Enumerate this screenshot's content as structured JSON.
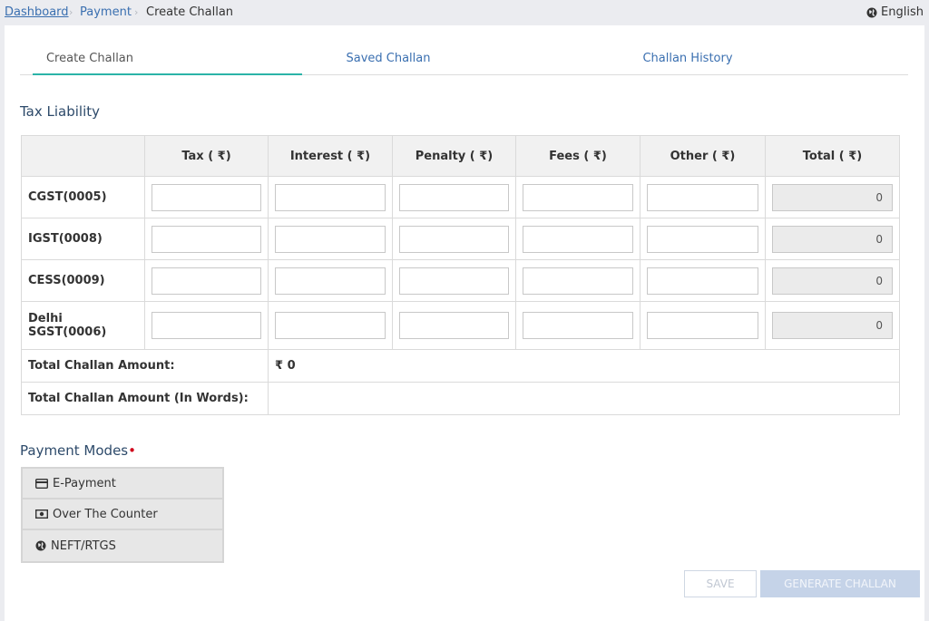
{
  "breadcrumb": {
    "items": [
      "Dashboard",
      "Payment",
      "Create Challan"
    ],
    "separator": "›"
  },
  "language": {
    "label": "English",
    "icon": "globe-icon"
  },
  "tabs": [
    {
      "label": "Create Challan",
      "active": true
    },
    {
      "label": "Saved Challan",
      "active": false
    },
    {
      "label": "Challan History",
      "active": false
    }
  ],
  "tax_liability": {
    "title": "Tax Liability",
    "columns": [
      "",
      "Tax ( ₹)",
      "Interest ( ₹)",
      "Penalty ( ₹)",
      "Fees ( ₹)",
      "Other ( ₹)",
      "Total ( ₹)"
    ],
    "rows": [
      {
        "label": "CGST(0005)",
        "total": "0"
      },
      {
        "label": "IGST(0008)",
        "total": "0"
      },
      {
        "label": "CESS(0009)",
        "total": "0"
      },
      {
        "label": "Delhi SGST(0006)",
        "total": "0"
      }
    ],
    "total_amount_label": "Total Challan Amount:",
    "total_amount_value": "₹ 0",
    "total_words_label": "Total Challan Amount (In Words):",
    "total_words_value": ""
  },
  "payment_modes": {
    "title": "Payment Modes",
    "required_mark": "•",
    "options": [
      {
        "label": "E-Payment",
        "icon": "credit-card-icon"
      },
      {
        "label": "Over The Counter",
        "icon": "cash-icon"
      },
      {
        "label": "NEFT/RTGS",
        "icon": "globe-icon"
      }
    ]
  },
  "actions": {
    "save_label": "SAVE",
    "generate_label": "GENERATE CHALLAN"
  },
  "colors": {
    "accent_tab": "#2bb3a8",
    "link": "#3a6fb0",
    "required": "#d0021b",
    "page_bg": "#ebecf0"
  }
}
